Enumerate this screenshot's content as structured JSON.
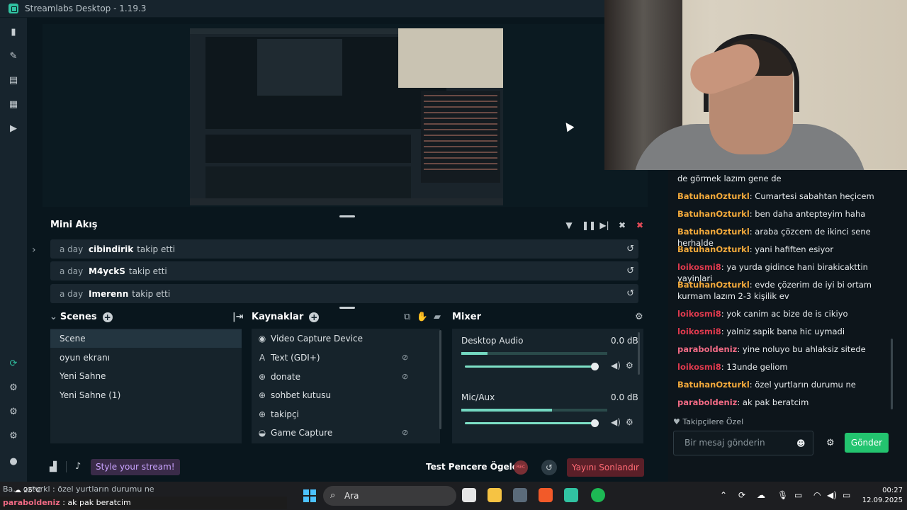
{
  "app": {
    "title": "Streamlabs Desktop - 1.19.3"
  },
  "mini_feed": {
    "title": "Mini Akış",
    "events": [
      {
        "time": "a day",
        "user": "cibindirik",
        "action": "takip etti"
      },
      {
        "time": "a day",
        "user": "M4yckS",
        "action": "takip etti"
      },
      {
        "time": "a day",
        "user": "Imerenn",
        "action": "takip etti"
      }
    ]
  },
  "scenes": {
    "title": "Scenes",
    "items": [
      "Scene",
      "oyun ekranı",
      "Yeni Sahne",
      "Yeni Sahne (1)"
    ],
    "selected_index": 0
  },
  "sources": {
    "title": "Kaynaklar",
    "items": [
      {
        "label": "Video Capture Device",
        "icon": "webcam-icon",
        "hidden": false
      },
      {
        "label": "Text (GDI+)",
        "icon": "text-icon",
        "hidden": true
      },
      {
        "label": "donate",
        "icon": "globe-icon",
        "hidden": true
      },
      {
        "label": "sohbet kutusu",
        "icon": "globe-icon",
        "hidden": false
      },
      {
        "label": "takipçi",
        "icon": "globe-icon",
        "hidden": false
      },
      {
        "label": "Game Capture",
        "icon": "gamepad-icon",
        "hidden": true
      }
    ]
  },
  "mixer": {
    "title": "Mixer",
    "channels": [
      {
        "name": "Desktop Audio",
        "db": "0.0 dB",
        "level": 0.18,
        "volume": 1.0
      },
      {
        "name": "Mic/Aux",
        "db": "0.0 dB",
        "level": 0.62,
        "volume": 1.0
      }
    ]
  },
  "footer": {
    "style_label": "Style your stream!",
    "test_label": "Test Pencere Ögeleri",
    "rec_label": "REC",
    "end_label": "Yayını Sonlandır"
  },
  "chat": {
    "first_line": "de görmek lazım gene de",
    "messages": [
      {
        "user": "BatuhanOzturkl",
        "color": "#f2a93b",
        "text": "Cumartesi sabahtan heçicem"
      },
      {
        "user": "BatuhanOzturkl",
        "color": "#f2a93b",
        "text": "ben daha antepteyim haha"
      },
      {
        "user": "BatuhanOzturkl",
        "color": "#f2a93b",
        "text": "araba çözcem de ikinci sene herhalde"
      },
      {
        "user": "BatuhanOzturkl",
        "color": "#f2a93b",
        "text": "yani hafiften esiyor"
      },
      {
        "user": "loikosmi8",
        "color": "#e03a4e",
        "text": "ya yurda gidince hani birakicakttin yayinlari"
      },
      {
        "user": "BatuhanOzturkl",
        "color": "#f2a93b",
        "text": "evde çözerim de iyi bi ortam kurmam lazım 2-3 kişilik ev"
      },
      {
        "user": "loikosmi8",
        "color": "#e03a4e",
        "text": "yok canim ac bize de is cikiyo"
      },
      {
        "user": "loikosmi8",
        "color": "#e03a4e",
        "text": "yalniz sapik bana hic uymadi"
      },
      {
        "user": "paraboldeniz",
        "color": "#f16a84",
        "text": "yine noluyo bu ahlaksiz sitede"
      },
      {
        "user": "loikosmi8",
        "color": "#e03a4e",
        "text": "13unde geliom"
      },
      {
        "user": "BatuhanOzturkl",
        "color": "#f2a93b",
        "text": "özel yurtların durumu ne"
      },
      {
        "user": "paraboldeniz",
        "color": "#f16a84",
        "text": "ak pak beratcim"
      }
    ],
    "followers_only": "Takipçilere Özel",
    "input_placeholder": "Bir mesaj gönderin",
    "send_label": "Gönder"
  },
  "stream_overlay": {
    "line1": "Ba… ozturkl : özel yurtların durumu ne",
    "line2_user": "paraboldeniz",
    "line2_text": ": ak pak beratcim"
  },
  "taskbar": {
    "weather": "25°C",
    "search_placeholder": "Ara",
    "time": "00:27",
    "date": "12.09.2025"
  }
}
